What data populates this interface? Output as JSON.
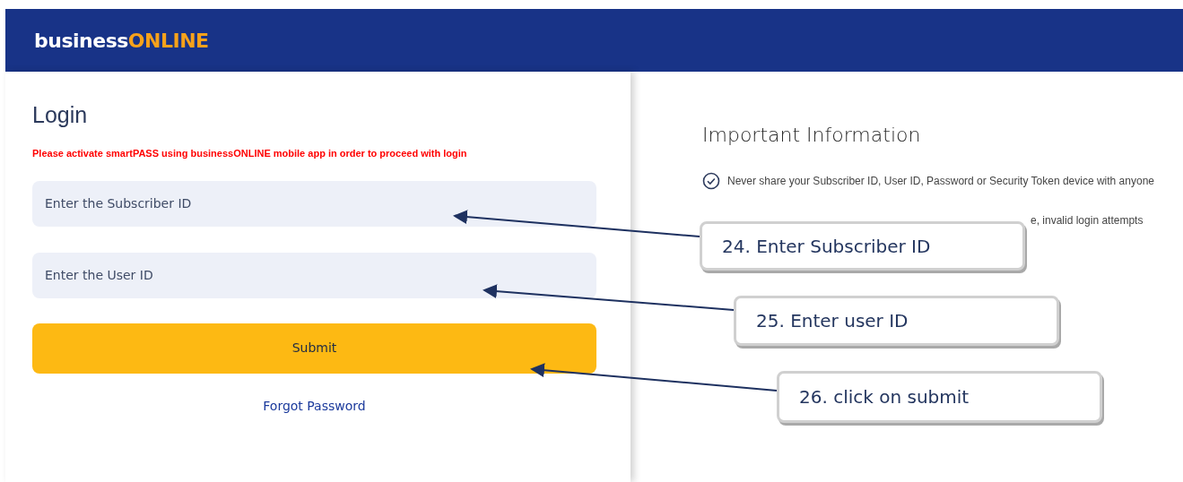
{
  "header": {
    "logo_part_1": "business",
    "logo_part_2": "ONLINE"
  },
  "login": {
    "title": "Login",
    "notice": "Please activate smartPASS using businessONLINE mobile app in order to proceed with login",
    "fields": [
      {
        "placeholder": "Enter the Subscriber ID"
      },
      {
        "placeholder": "Enter the User ID"
      }
    ],
    "submit": "Submit",
    "forgot_link": "Forgot Password"
  },
  "info": {
    "title": "Important Information",
    "items": [
      {
        "text": "Never share your Subscriber ID, User ID, Password or Security Token device with anyone"
      },
      {
        "text": "e, invalid login attempts"
      }
    ]
  },
  "callouts": [
    {
      "text": "24. Enter Subscriber ID"
    },
    {
      "text": "25. Enter user ID"
    },
    {
      "text": "26. click on submit"
    }
  ]
}
